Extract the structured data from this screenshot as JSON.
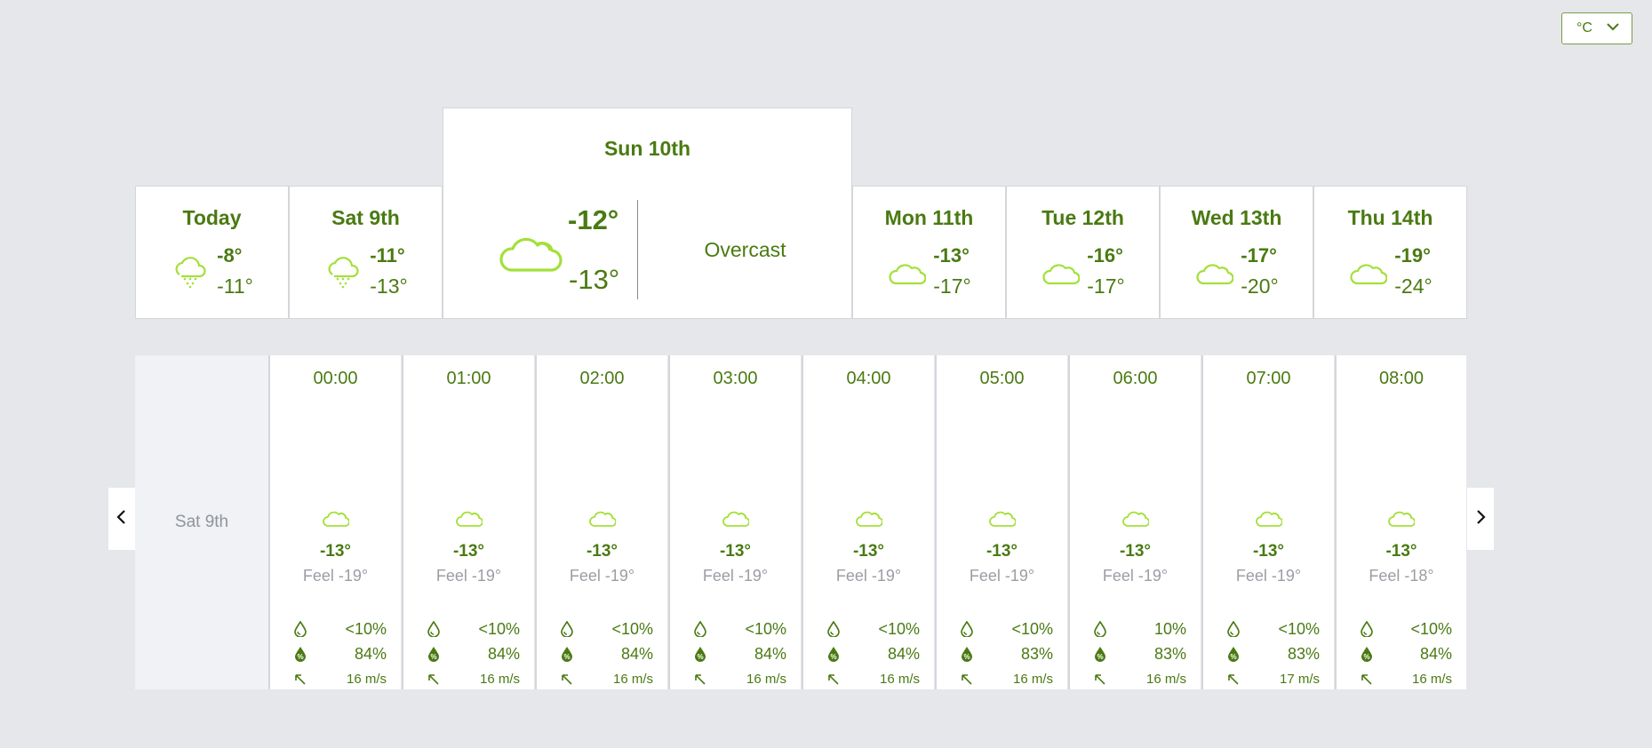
{
  "unit_select": {
    "value": "°C",
    "icon": "chevron-down-icon"
  },
  "colors": {
    "accent": "#4a7a12",
    "icon": "#a3e03a",
    "muted": "#9a9ea4",
    "background": "#e6e7ea"
  },
  "days": [
    {
      "name": "Today",
      "high": "-8°",
      "low": "-11°",
      "icon": "snow-cloud-icon"
    },
    {
      "name": "Sat 9th",
      "high": "-11°",
      "low": "-13°",
      "icon": "snow-cloud-icon"
    },
    {
      "name": "Mon 11th",
      "high": "-13°",
      "low": "-17°",
      "icon": "cloud-icon"
    },
    {
      "name": "Tue 12th",
      "high": "-16°",
      "low": "-17°",
      "icon": "cloud-icon"
    },
    {
      "name": "Wed 13th",
      "high": "-17°",
      "low": "-20°",
      "icon": "cloud-icon"
    },
    {
      "name": "Thu 14th",
      "high": "-19°",
      "low": "-24°",
      "icon": "cloud-icon"
    }
  ],
  "selected_day": {
    "name": "Sun 10th",
    "high": "-12°",
    "low": "-13°",
    "condition": "Overcast",
    "icon": "cloud-icon"
  },
  "hourly": {
    "day_label": "Sat 9th",
    "hours": [
      {
        "time": "00:00",
        "temp": "-13°",
        "feel": "Feel -19°",
        "precip": "<10%",
        "humidity": "84%",
        "wind": "16 m/s"
      },
      {
        "time": "01:00",
        "temp": "-13°",
        "feel": "Feel -19°",
        "precip": "<10%",
        "humidity": "84%",
        "wind": "16 m/s"
      },
      {
        "time": "02:00",
        "temp": "-13°",
        "feel": "Feel -19°",
        "precip": "<10%",
        "humidity": "84%",
        "wind": "16 m/s"
      },
      {
        "time": "03:00",
        "temp": "-13°",
        "feel": "Feel -19°",
        "precip": "<10%",
        "humidity": "84%",
        "wind": "16 m/s"
      },
      {
        "time": "04:00",
        "temp": "-13°",
        "feel": "Feel -19°",
        "precip": "<10%",
        "humidity": "84%",
        "wind": "16 m/s"
      },
      {
        "time": "05:00",
        "temp": "-13°",
        "feel": "Feel -19°",
        "precip": "<10%",
        "humidity": "83%",
        "wind": "16 m/s"
      },
      {
        "time": "06:00",
        "temp": "-13°",
        "feel": "Feel -19°",
        "precip": "10%",
        "humidity": "83%",
        "wind": "16 m/s"
      },
      {
        "time": "07:00",
        "temp": "-13°",
        "feel": "Feel -19°",
        "precip": "<10%",
        "humidity": "83%",
        "wind": "17 m/s"
      },
      {
        "time": "08:00",
        "temp": "-13°",
        "feel": "Feel -18°",
        "precip": "<10%",
        "humidity": "84%",
        "wind": "16 m/s"
      }
    ]
  },
  "nav": {
    "prev_icon": "chevron-left-icon",
    "next_icon": "chevron-right-icon"
  }
}
